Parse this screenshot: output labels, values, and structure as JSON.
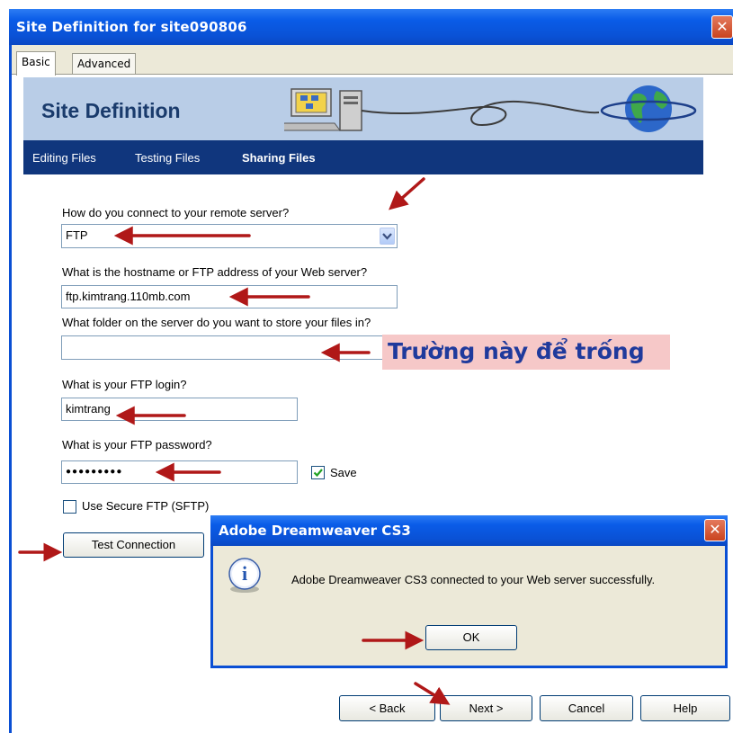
{
  "window": {
    "title": "Site Definition for site090806",
    "close_symbol": "✕"
  },
  "tabs": [
    {
      "label": "Basic"
    },
    {
      "label": "Advanced"
    }
  ],
  "banner": {
    "title": "Site Definition"
  },
  "nav": {
    "items": [
      {
        "label": "Editing Files"
      },
      {
        "label": "Testing Files"
      },
      {
        "label": "Sharing Files"
      }
    ]
  },
  "form": {
    "connect_question": "How do you connect to your remote server?",
    "connect_value": "FTP",
    "host_question": "What is the hostname or FTP address of your Web server?",
    "host_value": "ftp.kimtrang.110mb.com",
    "folder_question": "What folder on the server do you want to store your files in?",
    "folder_value": "",
    "login_question": "What is your FTP login?",
    "login_value": "kimtrang",
    "password_question": "What is your FTP password?",
    "password_value": "●●●●●●●●●",
    "save_label": "Save",
    "save_checked": true,
    "sftp_label": "Use Secure FTP (SFTP)",
    "sftp_checked": false,
    "test_button": "Test Connection"
  },
  "annotation": {
    "note": "Trường này để trống"
  },
  "popup": {
    "title": "Adobe Dreamweaver CS3",
    "message": "Adobe Dreamweaver CS3 connected to your Web server successfully.",
    "ok": "OK",
    "info_symbol": "i"
  },
  "buttons": {
    "back": "< Back",
    "next": "Next >",
    "cancel": "Cancel",
    "help": "Help"
  },
  "colors": {
    "title_bar": "#0a52d6",
    "nav_bar": "#10367d",
    "banner": "#b9cde7",
    "arrow": "#b01818",
    "note_bg": "#f6c8c8",
    "note_text": "#1f3a9c"
  }
}
